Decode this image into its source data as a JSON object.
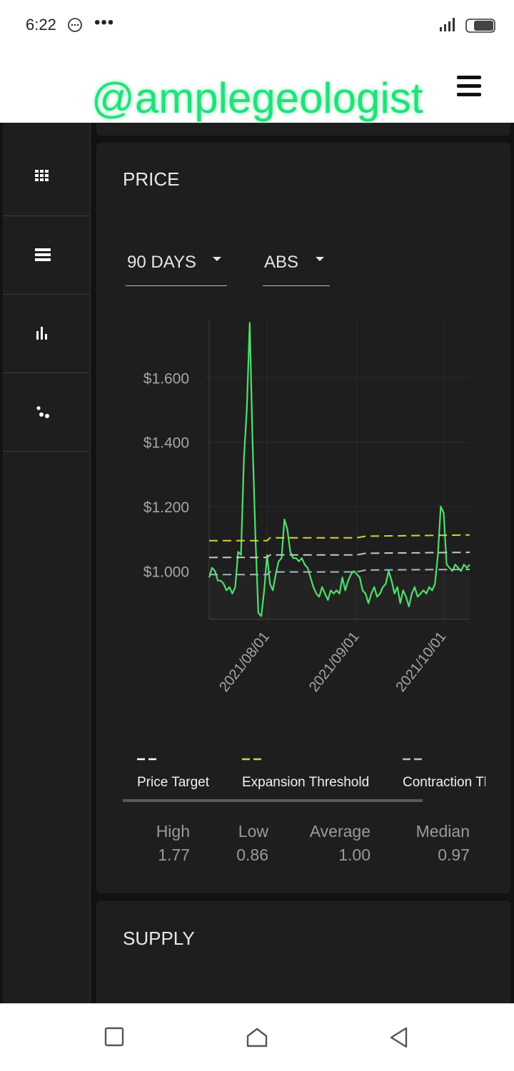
{
  "status_bar": {
    "time": "6:22"
  },
  "watermark": "@amplegeologist",
  "sidebar": {
    "items": [
      {
        "icon": "grid-icon"
      },
      {
        "icon": "list-icon"
      },
      {
        "icon": "bar-chart-icon"
      },
      {
        "icon": "scatter-icon"
      }
    ]
  },
  "price_card": {
    "title": "PRICE",
    "period_select": "90 DAYS",
    "mode_select": "ABS",
    "legend": [
      {
        "label": "Price Target",
        "color": "#ffffff"
      },
      {
        "label": "Expansion Threshold",
        "color": "#d6d23a"
      },
      {
        "label": "Contraction Threshold",
        "color": "#9fc7e6"
      }
    ],
    "stats": [
      {
        "label": "High",
        "value": "1.77"
      },
      {
        "label": "Low",
        "value": "0.86"
      },
      {
        "label": "Average",
        "value": "1.00"
      },
      {
        "label": "Median",
        "value": "0.97"
      }
    ]
  },
  "supply_card": {
    "title": "SUPPLY"
  },
  "chart_data": {
    "type": "line",
    "title": "",
    "xlabel": "",
    "ylabel": "",
    "x_tick_labels": [
      "2021/08/01",
      "2021/09/01",
      "2021/10/01"
    ],
    "y_tick_labels": [
      "$1.600",
      "$1.400",
      "$1.200",
      "$1.000"
    ],
    "y_ticks": [
      1.6,
      1.4,
      1.2,
      1.0
    ],
    "ylim": [
      0.85,
      1.78
    ],
    "x_range": [
      "2021-07-12",
      "2021-10-10"
    ],
    "grid": true,
    "series": [
      {
        "name": "Price",
        "color": "#4ee06a",
        "x": [
          "2021-07-12",
          "2021-07-13",
          "2021-07-14",
          "2021-07-15",
          "2021-07-16",
          "2021-07-17",
          "2021-07-18",
          "2021-07-19",
          "2021-07-20",
          "2021-07-21",
          "2021-07-22",
          "2021-07-23",
          "2021-07-24",
          "2021-07-25",
          "2021-07-26",
          "2021-07-27",
          "2021-07-28",
          "2021-07-29",
          "2021-07-30",
          "2021-07-31",
          "2021-08-01",
          "2021-08-02",
          "2021-08-03",
          "2021-08-04",
          "2021-08-05",
          "2021-08-06",
          "2021-08-07",
          "2021-08-08",
          "2021-08-09",
          "2021-08-10",
          "2021-08-11",
          "2021-08-12",
          "2021-08-13",
          "2021-08-14",
          "2021-08-15",
          "2021-08-16",
          "2021-08-17",
          "2021-08-18",
          "2021-08-19",
          "2021-08-20",
          "2021-08-21",
          "2021-08-22",
          "2021-08-23",
          "2021-08-24",
          "2021-08-25",
          "2021-08-26",
          "2021-08-27",
          "2021-08-28",
          "2021-08-29",
          "2021-08-30",
          "2021-08-31",
          "2021-09-01",
          "2021-09-02",
          "2021-09-03",
          "2021-09-04",
          "2021-09-05",
          "2021-09-06",
          "2021-09-07",
          "2021-09-08",
          "2021-09-09",
          "2021-09-10",
          "2021-09-11",
          "2021-09-12",
          "2021-09-13",
          "2021-09-14",
          "2021-09-15",
          "2021-09-16",
          "2021-09-17",
          "2021-09-18",
          "2021-09-19",
          "2021-09-20",
          "2021-09-21",
          "2021-09-22",
          "2021-09-23",
          "2021-09-24",
          "2021-09-25",
          "2021-09-26",
          "2021-09-27",
          "2021-09-28",
          "2021-09-29",
          "2021-09-30",
          "2021-10-01",
          "2021-10-02",
          "2021-10-03",
          "2021-10-04",
          "2021-10-05",
          "2021-10-06",
          "2021-10-07",
          "2021-10-08",
          "2021-10-09",
          "2021-10-10"
        ],
        "y": [
          0.98,
          1.01,
          1.0,
          0.97,
          0.97,
          0.96,
          0.94,
          0.95,
          0.93,
          0.95,
          1.06,
          1.05,
          1.35,
          1.5,
          1.77,
          1.4,
          1.1,
          0.87,
          0.86,
          0.94,
          1.05,
          0.96,
          0.94,
          0.99,
          1.03,
          1.04,
          1.16,
          1.13,
          1.06,
          1.04,
          1.04,
          1.03,
          1.04,
          1.02,
          1.01,
          0.98,
          0.95,
          0.93,
          0.92,
          0.95,
          0.93,
          0.91,
          0.94,
          0.93,
          0.94,
          0.93,
          0.98,
          0.94,
          0.97,
          0.99,
          1.0,
          0.99,
          0.98,
          0.94,
          0.93,
          0.9,
          0.93,
          0.95,
          0.92,
          0.93,
          0.95,
          0.96,
          1.0,
          0.97,
          0.93,
          0.95,
          0.9,
          0.94,
          0.92,
          0.89,
          0.93,
          0.95,
          0.92,
          0.93,
          0.94,
          0.93,
          0.95,
          0.94,
          0.96,
          1.05,
          1.2,
          1.18,
          1.02,
          1.01,
          1.0,
          1.02,
          1.01,
          1.0,
          1.02,
          1.01,
          1.02
        ]
      },
      {
        "name": "Price Target",
        "color": "#c8c8c8",
        "x": [
          "2021-07-12",
          "2021-08-01",
          "2021-08-02",
          "2021-09-01",
          "2021-09-04",
          "2021-10-10"
        ],
        "y": [
          1.042,
          1.042,
          1.05,
          1.05,
          1.055,
          1.058
        ]
      },
      {
        "name": "Expansion Threshold",
        "color": "#d6d23a",
        "x": [
          "2021-07-12",
          "2021-08-01",
          "2021-08-02",
          "2021-09-01",
          "2021-09-04",
          "2021-10-10"
        ],
        "y": [
          1.094,
          1.094,
          1.103,
          1.103,
          1.108,
          1.112
        ]
      },
      {
        "name": "Contraction Threshold",
        "color": "#9fb8c8",
        "x": [
          "2021-07-12",
          "2021-08-01",
          "2021-08-02",
          "2021-09-01",
          "2021-09-04",
          "2021-10-10"
        ],
        "y": [
          0.989,
          0.989,
          0.997,
          0.997,
          1.003,
          1.005
        ]
      }
    ]
  }
}
